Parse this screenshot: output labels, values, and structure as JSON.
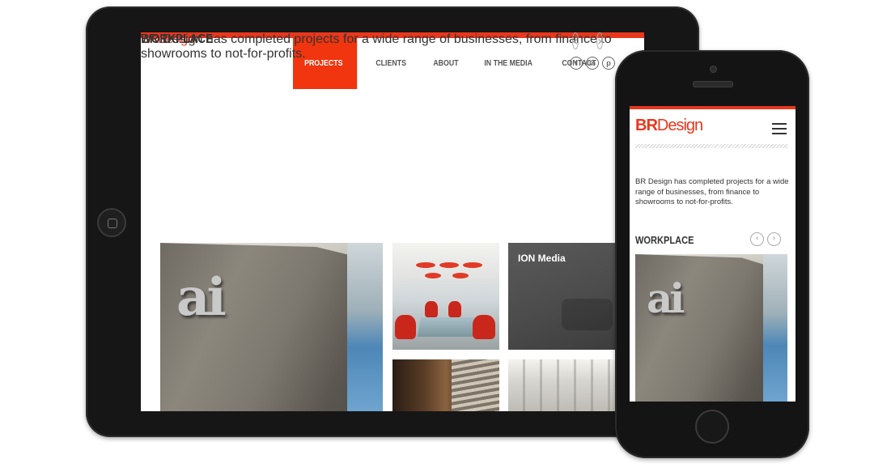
{
  "brand": {
    "bold": "BR",
    "rest": "Design",
    "accent": "#e8371d"
  },
  "nav": {
    "items": [
      {
        "label": "PROJECTS",
        "active": true
      },
      {
        "label": "CLIENTS",
        "active": false
      },
      {
        "label": "ABOUT",
        "active": false
      },
      {
        "label": "IN THE MEDIA",
        "active": false
      },
      {
        "label": "CONTACT",
        "active": false
      }
    ]
  },
  "social": [
    {
      "icon": "facebook-icon",
      "glyph": "f"
    },
    {
      "icon": "linkedin-icon",
      "glyph": "in"
    },
    {
      "icon": "pinterest-icon",
      "glyph": "p"
    }
  ],
  "tablet": {
    "intro": "BR Design has completed projects for a wide range of businesses, from finance to showrooms to not-for-profits.",
    "section_title": "WORKPLACE",
    "tiles": [
      {
        "caption": ""
      },
      {
        "caption": ""
      },
      {
        "caption": "ION Media"
      },
      {
        "caption": ""
      },
      {
        "caption": ""
      }
    ]
  },
  "phone": {
    "intro": "BR Design has completed projects for a wide range of businesses, from finance to showrooms to not-for-profits.",
    "section_title": "WORKPLACE"
  },
  "arrows": {
    "prev": "‹",
    "next": "›"
  },
  "wall_mark": "ai"
}
